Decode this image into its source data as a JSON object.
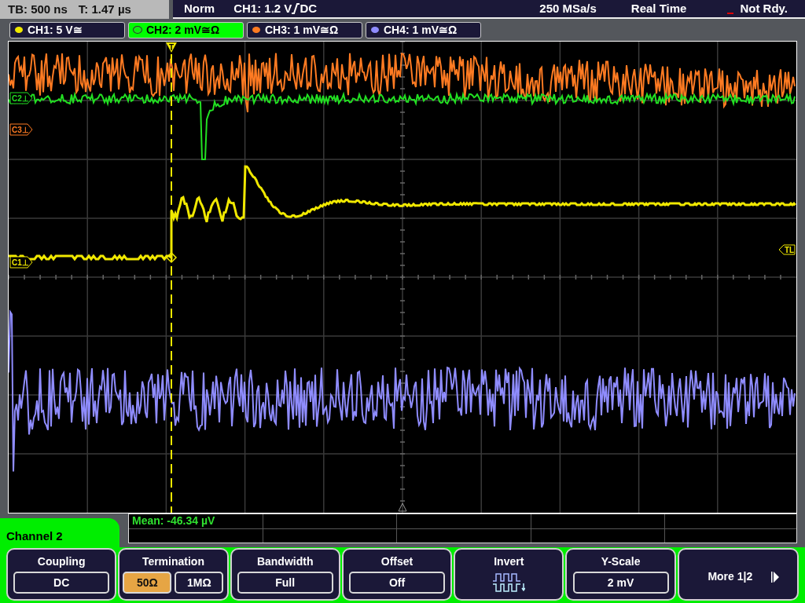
{
  "status_bar": {
    "timebase": "TB: 500 ns",
    "trigger_time": "T: 1.47 µs",
    "mode": "Norm",
    "trigger_source": "CH1: 1.2 V",
    "trigger_coupling": "DC",
    "sample_rate": "250 MSa/s",
    "acquisition": "Real Time",
    "state": "Not Rdy."
  },
  "channels": [
    {
      "label": "CH1: 5 V≅",
      "color": "#f0e800",
      "selected": false
    },
    {
      "label": "CH2: 2 mV≅Ω",
      "color": "#22e022",
      "selected": true
    },
    {
      "label": "CH3: 1 mV≅Ω",
      "color": "#ff7b22",
      "selected": false
    },
    {
      "label": "CH4: 1 mV≅Ω",
      "color": "#8f8cff",
      "selected": false
    }
  ],
  "plot": {
    "trigger_marker": "T",
    "markers": [
      {
        "label": "C2⊥"
      },
      {
        "label": "C3⊥"
      },
      {
        "label": "C1⊥"
      }
    ],
    "trigger_level_marker": "TL"
  },
  "measurement": {
    "readout": "Mean: -46.34 µV"
  },
  "menu": {
    "title": "Channel 2",
    "softkeys": [
      {
        "kind": "value",
        "label": "Coupling",
        "value": "DC"
      },
      {
        "kind": "toggle",
        "label": "Termination",
        "options": [
          {
            "text": "50Ω",
            "selected": true
          },
          {
            "text": "1MΩ",
            "selected": false
          }
        ]
      },
      {
        "kind": "value",
        "label": "Bandwidth",
        "value": "Full"
      },
      {
        "kind": "value",
        "label": "Offset",
        "value": "Off"
      },
      {
        "kind": "icon",
        "label": "Invert"
      },
      {
        "kind": "value",
        "label": "Y-Scale",
        "value": "2 mV"
      },
      {
        "kind": "next",
        "label": "More 1|2"
      }
    ]
  }
}
